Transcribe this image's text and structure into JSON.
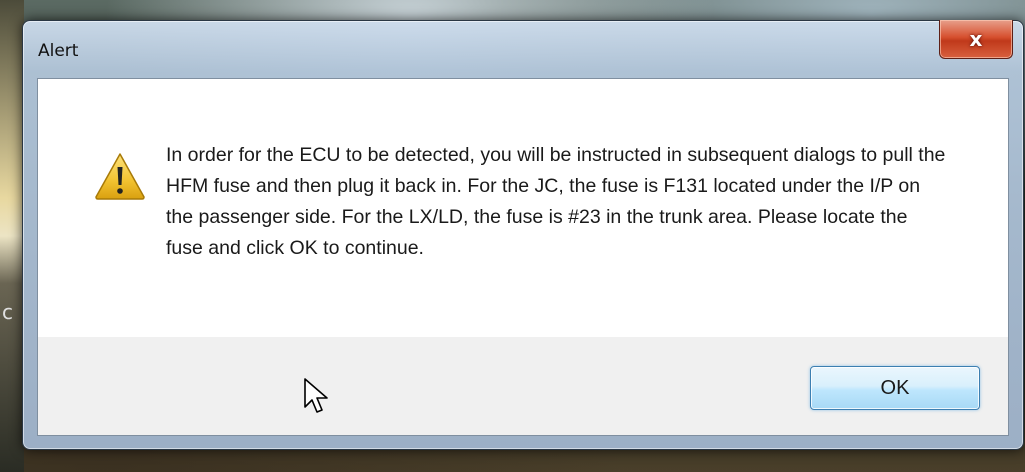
{
  "dialog": {
    "title": "Alert",
    "close_glyph": "x",
    "message": "In order for the ECU to be detected, you will be instructed in subsequent dialogs to pull the HFM fuse and then plug it back in. For the JC, the fuse is F131 located under the I/P on the passenger side. For the LX/LD, the fuse is #23 in the trunk area. Please locate the fuse and click OK to continue.",
    "icon": "warning-icon",
    "ok_label": "OK"
  },
  "background": {
    "edge_glyph": "c"
  },
  "colors": {
    "close_button": "#c8452a",
    "ok_border": "#3c7fb1",
    "warning_yellow": "#f2c230"
  }
}
